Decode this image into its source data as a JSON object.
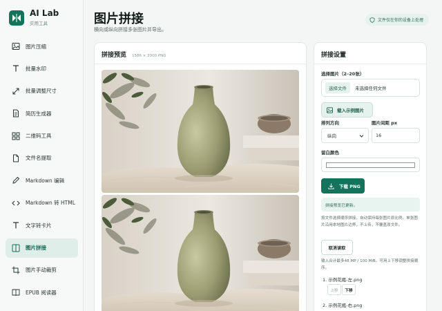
{
  "app": {
    "title": "AI Lab",
    "subtitle": "实用工具"
  },
  "nav": [
    {
      "label": "图片压缩",
      "icon": "image-icon"
    },
    {
      "label": "批量水印",
      "icon": "text-icon"
    },
    {
      "label": "批量调整尺寸",
      "icon": "resize-icon"
    },
    {
      "label": "简历生成器",
      "icon": "document-icon"
    },
    {
      "label": "二维码工具",
      "icon": "grid-icon"
    },
    {
      "label": "文件名提取",
      "icon": "file-icon"
    },
    {
      "label": "Markdown 编辑",
      "icon": "pen-icon"
    },
    {
      "label": "Markdown 转 HTML",
      "icon": "code-icon"
    },
    {
      "label": "文字转卡片",
      "icon": "text-card-icon"
    },
    {
      "label": "图片拼接",
      "icon": "collage-icon",
      "active": true
    },
    {
      "label": "图片手动裁剪",
      "icon": "crop-icon"
    },
    {
      "label": "EPUB 阅读器",
      "icon": "book-icon"
    }
  ],
  "page": {
    "title": "图片拼接",
    "subtitle": "横向或纵向拼接多张图片并导出。",
    "badge": "文件仅在你的设备上处理"
  },
  "preview": {
    "title": "拼接预览",
    "meta": "1586 × 2000 PNG"
  },
  "settings": {
    "title": "拼接设置",
    "select_label": "选择图片（2–20张）",
    "choose_file_button": "选择文件",
    "no_file_text": "未选择任何文件",
    "sample_button": "载入示例图片",
    "direction_label": "排列方向",
    "direction_value": "纵向",
    "gap_label": "图片间距 px",
    "gap_value": "16",
    "bg_label": "留白颜色",
    "bg_color": "#ffffff",
    "download_button": "下载 PNG",
    "status": "拼接预览已更新。",
    "hint": "按文件选择顺序拼接，自动保持每张图片原比例。单张图片沿用本地图片边界，不上传，不覆盖原文件。",
    "cancel_button": "取消读取",
    "limit_hint": "输入合计最多48 MP / 100 MiB。可用上下移调整拼接顺序。",
    "files": [
      {
        "name": "1. 示例花瓶-左.png",
        "up": "上移",
        "down": "下移"
      },
      {
        "name": "2. 示例花瓶-右.png"
      }
    ]
  },
  "colors": {
    "accent": "#15735c",
    "accent_light": "#e6f2ed"
  }
}
